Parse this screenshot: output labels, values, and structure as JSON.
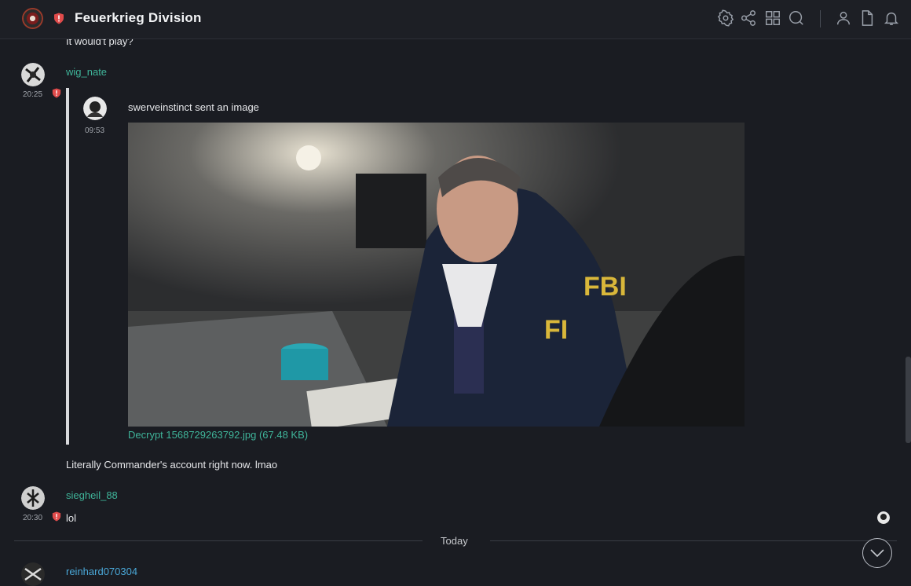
{
  "header": {
    "room_name": "Feuerkrieg Division",
    "icons": [
      "settings-icon",
      "share-icon",
      "apps-grid-icon",
      "search-icon",
      "people-icon",
      "files-icon",
      "notifications-icon"
    ]
  },
  "timeline": {
    "top_fragment": "It would't play?",
    "messages": [
      {
        "sender": "wig_nate",
        "time": "20:25",
        "quoted": {
          "time": "09:53",
          "text": "swerveinstinct sent an image",
          "file_label": "Decrypt 1568729263792.jpg (67.48 KB)"
        },
        "text": "Literally Commander's account right now. lmao"
      },
      {
        "sender": "siegheil_88",
        "time": "20:30",
        "text": "lol"
      }
    ],
    "day_separator": "Today",
    "last_sender": "reinhard070304"
  },
  "colors": {
    "background": "#1a1c22",
    "sender_green": "#3fb59a",
    "sender_blue": "#4aa8d8",
    "warning_red": "#e04b4b"
  }
}
